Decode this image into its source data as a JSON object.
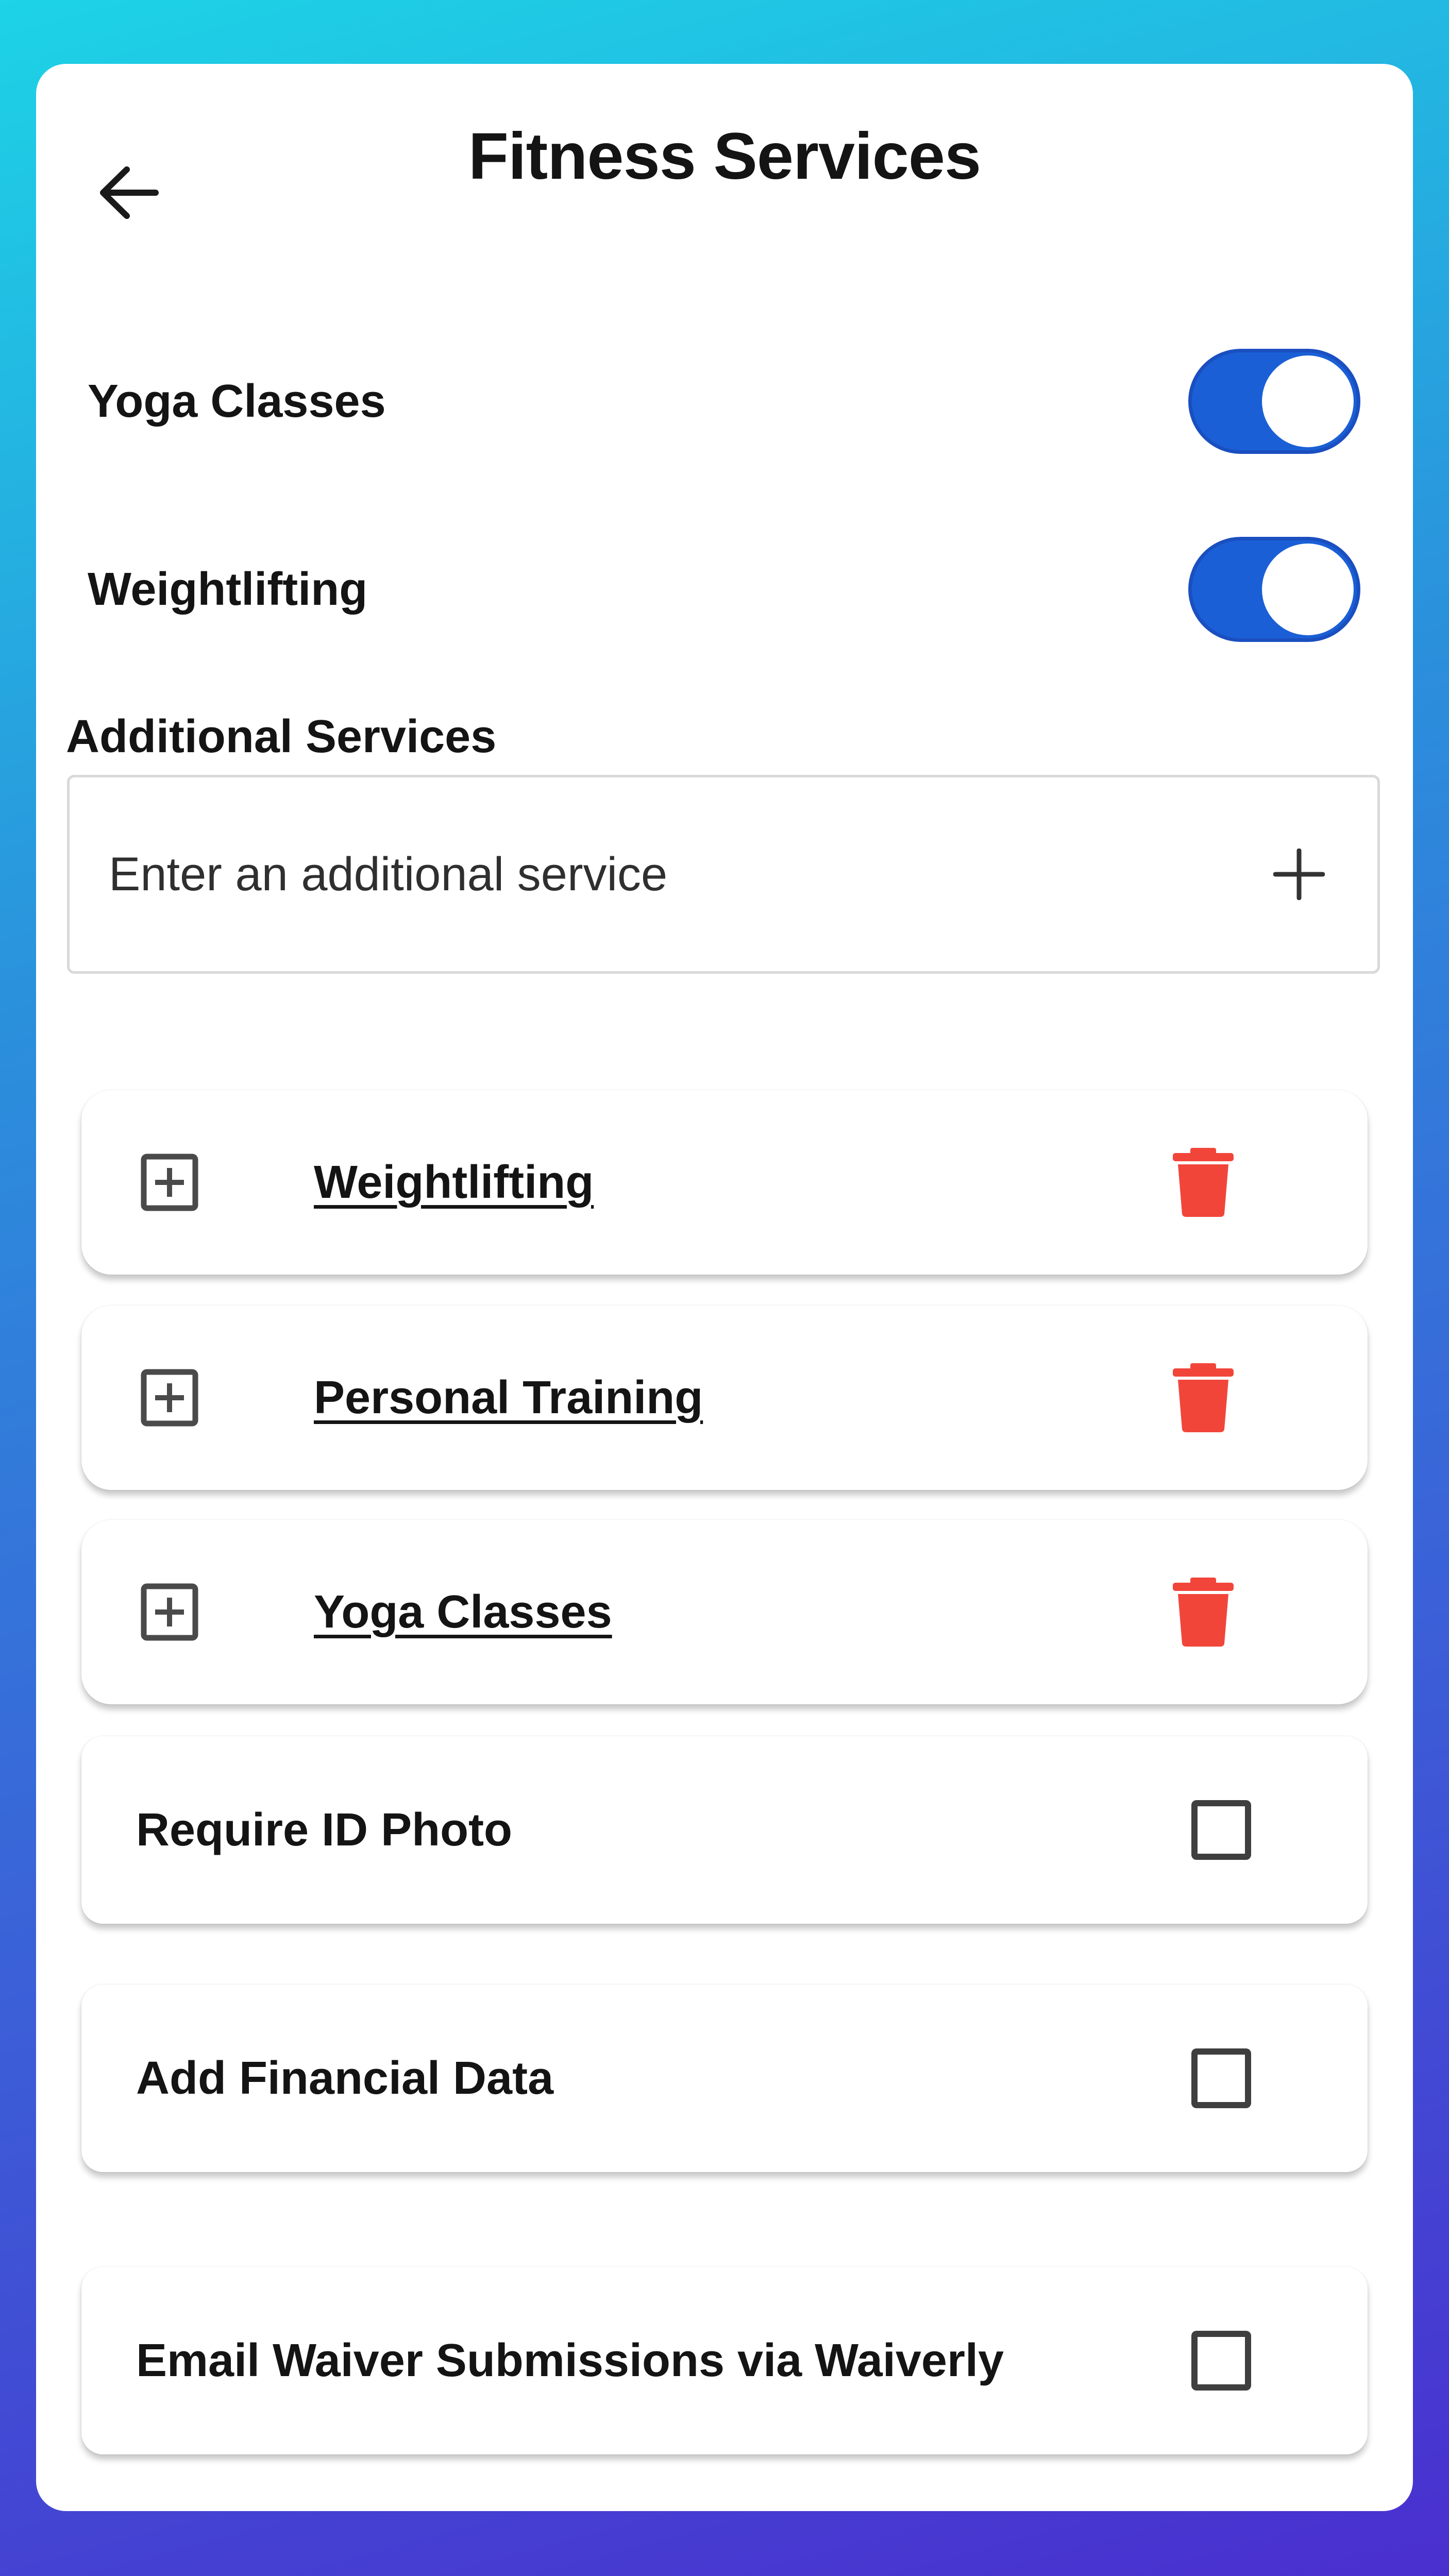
{
  "header": {
    "title": "Fitness Services",
    "back_icon": "arrow-left-icon"
  },
  "toggles": [
    {
      "label": "Yoga Classes",
      "on": true
    },
    {
      "label": "Weightlifting",
      "on": true
    }
  ],
  "additional": {
    "heading": "Additional Services",
    "placeholder": "Enter an additional service",
    "add_icon": "plus-icon"
  },
  "services": [
    {
      "name": "Weightlifting"
    },
    {
      "name": "Personal Training"
    },
    {
      "name": "Yoga Classes"
    }
  ],
  "options": [
    {
      "label": "Require ID Photo",
      "checked": false
    },
    {
      "label": "Add Financial Data",
      "checked": false
    },
    {
      "label": "Email Waiver Submissions via Waiverly",
      "checked": false
    }
  ],
  "colors": {
    "toggle_on": "#1a5fd6",
    "delete": "#f2453a",
    "text": "#141414"
  }
}
